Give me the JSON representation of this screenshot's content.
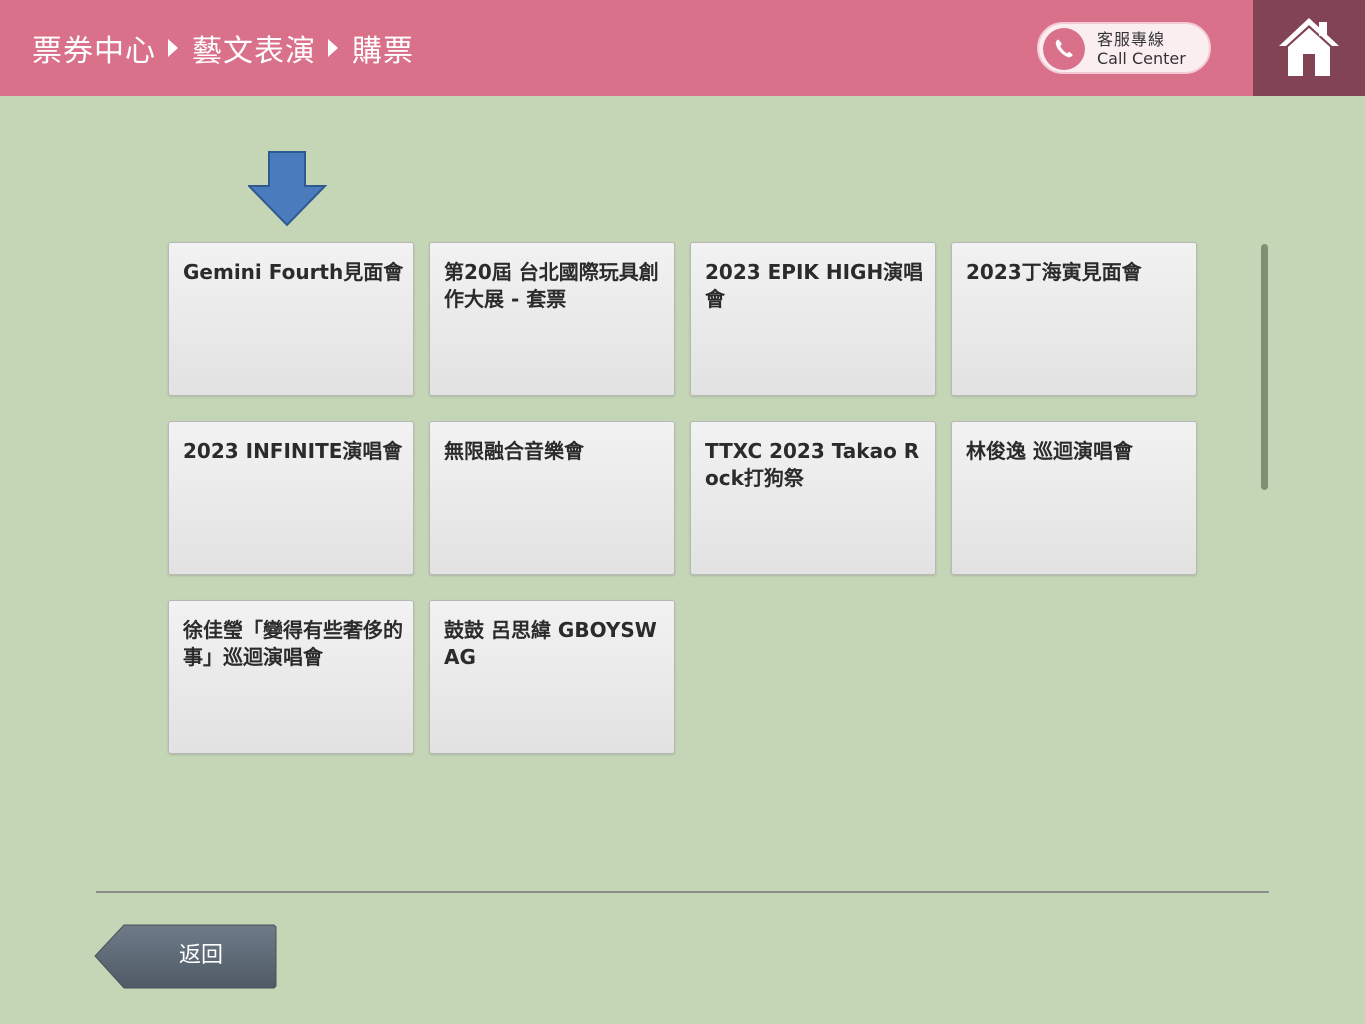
{
  "header": {
    "breadcrumb": [
      "票券中心",
      "藝文表演",
      "購票"
    ],
    "call_center": {
      "label_zh": "客服專線",
      "label_en": "Call Center",
      "icon": "phone-icon"
    },
    "home_icon": "home-icon",
    "color": "#da718b",
    "home_color": "#824454"
  },
  "events": [
    {
      "label": "Gemini Fourth見面會"
    },
    {
      "label": "第20屆 台北國際玩具創作大展 - 套票"
    },
    {
      "label": "2023 EPIK HIGH演唱會"
    },
    {
      "label": "2023丁海寅見面會"
    },
    {
      "label": "2023 INFINITE演唱會"
    },
    {
      "label": "無限融合音樂會"
    },
    {
      "label": "TTXC 2023 Takao Rock打狗祭"
    },
    {
      "label": "林俊逸 巡迴演唱會"
    },
    {
      "label": "徐佳瑩「變得有些奢侈的事」巡迴演唱會"
    },
    {
      "label": "鼓鼓 呂思緯 GBOYSWAG"
    }
  ],
  "footer": {
    "back_label": "返回"
  },
  "colors": {
    "background": "#c5d6b6",
    "indicator_arrow": "#4a7bbd",
    "back_button": "#5f6b78"
  }
}
